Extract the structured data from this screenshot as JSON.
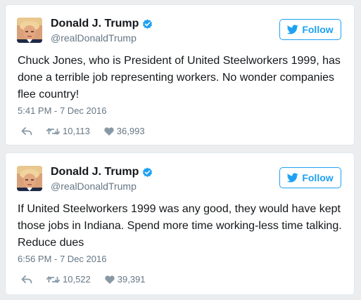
{
  "colors": {
    "background": "#ecedee",
    "accent": "#1da1f2",
    "text": "#14171a",
    "muted": "#657786"
  },
  "tweets": [
    {
      "author_name": "Donald J. Trump",
      "handle": "@realDonaldTrump",
      "verified_icon": "verified-badge-icon",
      "follow_label": "Follow",
      "text": "Chuck Jones, who is President of United Steelworkers 1999, has done a terrible job representing workers. No wonder companies flee country!",
      "timestamp": "5:41 PM - 7 Dec 2016",
      "retweets": "10,113",
      "likes": "36,993"
    },
    {
      "author_name": "Donald J. Trump",
      "handle": "@realDonaldTrump",
      "verified_icon": "verified-badge-icon",
      "follow_label": "Follow",
      "text": "If United Steelworkers 1999 was any good, they would have kept those jobs in Indiana. Spend more time working-less time talking. Reduce dues",
      "timestamp": "6:56 PM - 7 Dec 2016",
      "retweets": "10,522",
      "likes": "39,391"
    }
  ]
}
